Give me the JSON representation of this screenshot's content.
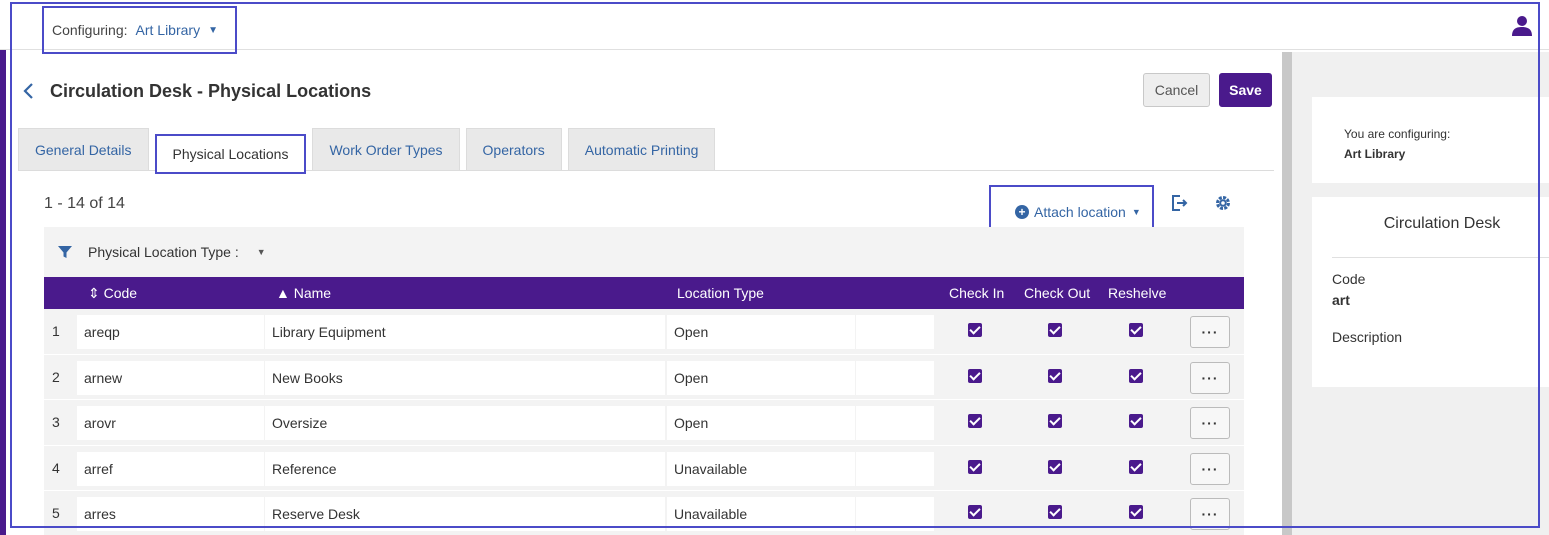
{
  "topbar": {
    "configuring_label": "Configuring:",
    "configuring_value": "Art Library"
  },
  "header": {
    "title": "Circulation Desk - Physical Locations",
    "cancel_label": "Cancel",
    "save_label": "Save"
  },
  "tabs": [
    {
      "label": "General Details"
    },
    {
      "label": "Physical Locations"
    },
    {
      "label": "Work Order Types"
    },
    {
      "label": "Operators"
    },
    {
      "label": "Automatic Printing"
    }
  ],
  "toolbar": {
    "count": "1 - 14 of 14",
    "attach_label": "Attach location"
  },
  "filter": {
    "label": "Physical Location Type :"
  },
  "table": {
    "columns": {
      "code": "Code",
      "name": "Name",
      "location_type": "Location Type",
      "check_in": "Check In",
      "check_out": "Check Out",
      "reshelve": "Reshelve"
    },
    "rows": [
      {
        "index": "1",
        "code": "areqp",
        "name": "Library Equipment",
        "type": "Open"
      },
      {
        "index": "2",
        "code": "arnew",
        "name": "New Books",
        "type": "Open"
      },
      {
        "index": "3",
        "code": "arovr",
        "name": "Oversize",
        "type": "Open"
      },
      {
        "index": "4",
        "code": "arref",
        "name": "Reference",
        "type": "Unavailable"
      },
      {
        "index": "5",
        "code": "arres",
        "name": "Reserve Desk",
        "type": "Unavailable"
      }
    ],
    "more_label": "···"
  },
  "side": {
    "configuring_label": "You are configuring:",
    "configuring_value": "Art Library",
    "panel_title": "Circulation Desk",
    "code_label": "Code",
    "code_value": "art",
    "description_label": "Description"
  },
  "colors": {
    "brand": "#4a1a8c",
    "link": "#3465a4",
    "highlight": "#4b4bc8"
  }
}
